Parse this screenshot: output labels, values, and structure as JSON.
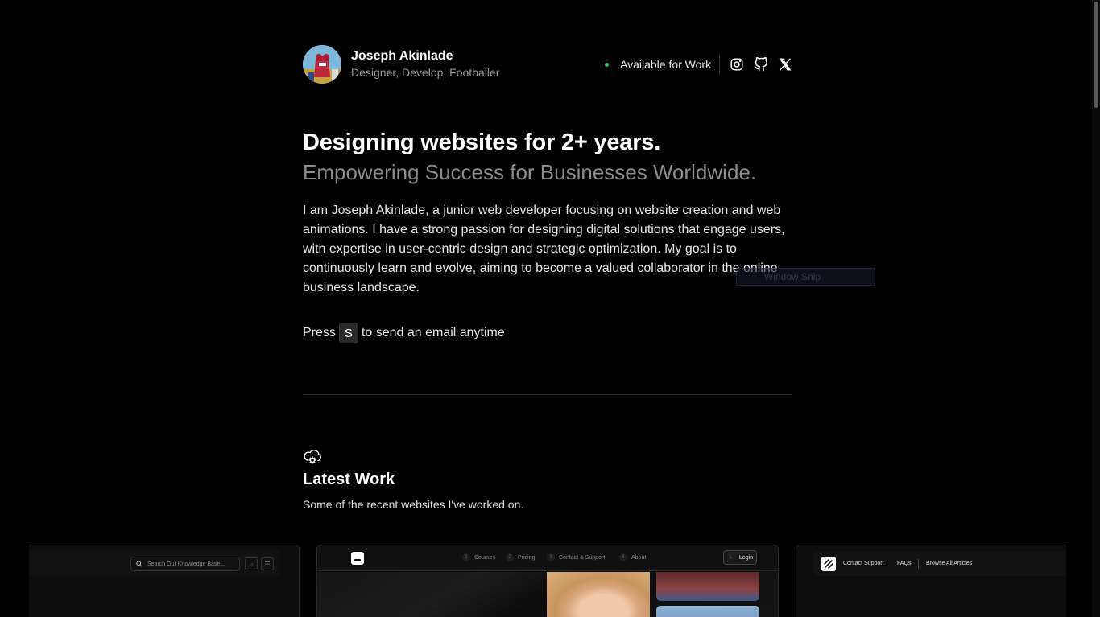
{
  "profile": {
    "name": "Joseph Akinlade",
    "tagline": "Designer, Develop, Footballer",
    "status": "Available for Work",
    "status_color": "#22c55e"
  },
  "social": [
    {
      "icon": "instagram-icon"
    },
    {
      "icon": "github-icon"
    },
    {
      "icon": "x-icon"
    }
  ],
  "hero": {
    "title": "Designing websites for 2+ years.",
    "subtitle": "Empowering Success for Businesses Worldwide.",
    "bio": "I am Joseph Akinlade, a junior web developer focusing on website creation and web animations. I have a strong passion for designing digital solutions that engage users, with expertise in user-centric design and strategic optimization. My goal is to continuously learn and evolve, aiming to become a valued collaborator in the online business landscape.",
    "press_before": "Press",
    "press_key": "S",
    "press_after": "to send an email anytime"
  },
  "overlay": {
    "snip_label": "Window Snip"
  },
  "latest_work": {
    "icon": "cloud-cog-icon",
    "title": "Latest Work",
    "subtitle": "Some of the recent websites I've worked on."
  },
  "cards": {
    "card1": {
      "search_placeholder": "Search Our Knowledge Base...",
      "theme_icon": "☼",
      "menu_icon": "☰"
    },
    "card2": {
      "nav": [
        {
          "num": "1",
          "label": "Courses"
        },
        {
          "num": "2",
          "label": "Pricing"
        },
        {
          "num": "3",
          "label": "Contact & Support"
        },
        {
          "num": "4",
          "label": "About"
        }
      ],
      "login_key": "L",
      "login_label": "Login"
    },
    "card3": {
      "nav": [
        "Contact Support",
        "FAQs",
        "Browse All Articles"
      ]
    }
  }
}
